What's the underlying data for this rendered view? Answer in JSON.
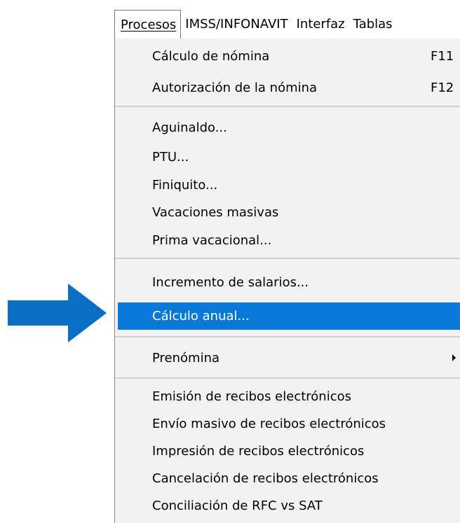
{
  "menubar": {
    "items": [
      {
        "label": "Procesos",
        "mnemonic": "P",
        "open": true
      },
      {
        "label": "IMSS/INFONAVIT",
        "mnemonic": "F"
      },
      {
        "label": "Interfaz",
        "mnemonic": "I"
      },
      {
        "label": "Tablas",
        "mnemonic": "T"
      }
    ]
  },
  "menu": {
    "items": [
      {
        "label": "Cálculo de nómina",
        "shortcut": "F11"
      },
      {
        "label": "Autorización de la nómina",
        "shortcut": "F12"
      },
      {
        "label": "Aguinaldo..."
      },
      {
        "label": "PTU..."
      },
      {
        "label": "Finiquito..."
      },
      {
        "label": "Vacaciones masivas"
      },
      {
        "label": "Prima vacacional..."
      },
      {
        "label": "Incremento de salarios..."
      },
      {
        "label": "Cálculo anual...",
        "highlighted": true
      },
      {
        "label": "Prenómina",
        "has_submenu": true
      },
      {
        "label": "Emisión de recibos electrónicos"
      },
      {
        "label": "Envío masivo de recibos electrónicos"
      },
      {
        "label": "Impresión de recibos electrónicos"
      },
      {
        "label": "Cancelación de recibos electrónicos"
      },
      {
        "label": "Conciliación de RFC vs SAT"
      }
    ]
  },
  "colors": {
    "highlight": "#0a78d7",
    "arrow": "#0a6fc2",
    "menu_background": "#f2f2f2"
  },
  "icons": {
    "pointer": "arrow-right-icon",
    "submenu": "submenu-arrow-icon"
  }
}
